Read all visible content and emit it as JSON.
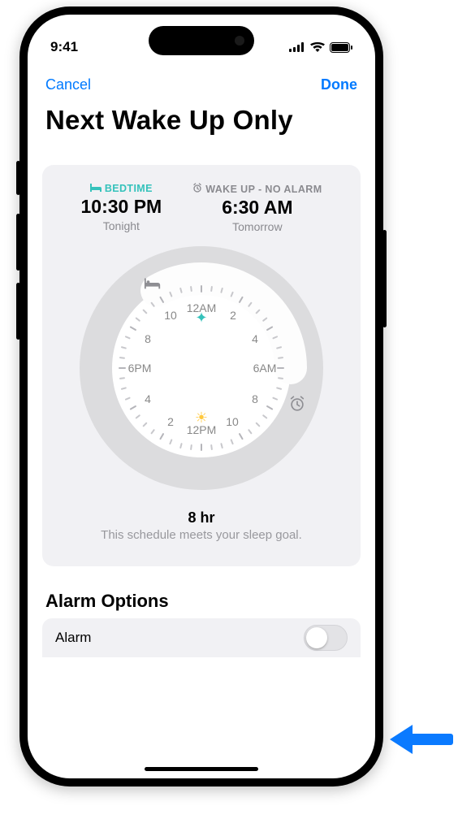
{
  "status": {
    "time": "9:41"
  },
  "nav": {
    "cancel": "Cancel",
    "done": "Done"
  },
  "title": "Next Wake Up Only",
  "bedtime": {
    "label": "BEDTIME",
    "time": "10:30 PM",
    "sub": "Tonight"
  },
  "wakeup": {
    "label": "WAKE UP - NO ALARM",
    "time": "6:30 AM",
    "sub": "Tomorrow"
  },
  "dial": {
    "h12am": "12AM",
    "h2a": "2",
    "h4a": "4",
    "h6am": "6AM",
    "h8a": "8",
    "h10a": "10",
    "h12pm": "12PM",
    "h2p": "2",
    "h4p": "4",
    "h6pm": "6PM",
    "h8p": "8",
    "h10p": "10"
  },
  "goal": {
    "duration": "8 hr",
    "note": "This schedule meets your sleep goal."
  },
  "options": {
    "heading": "Alarm Options",
    "alarm_label": "Alarm",
    "alarm_on": false
  }
}
